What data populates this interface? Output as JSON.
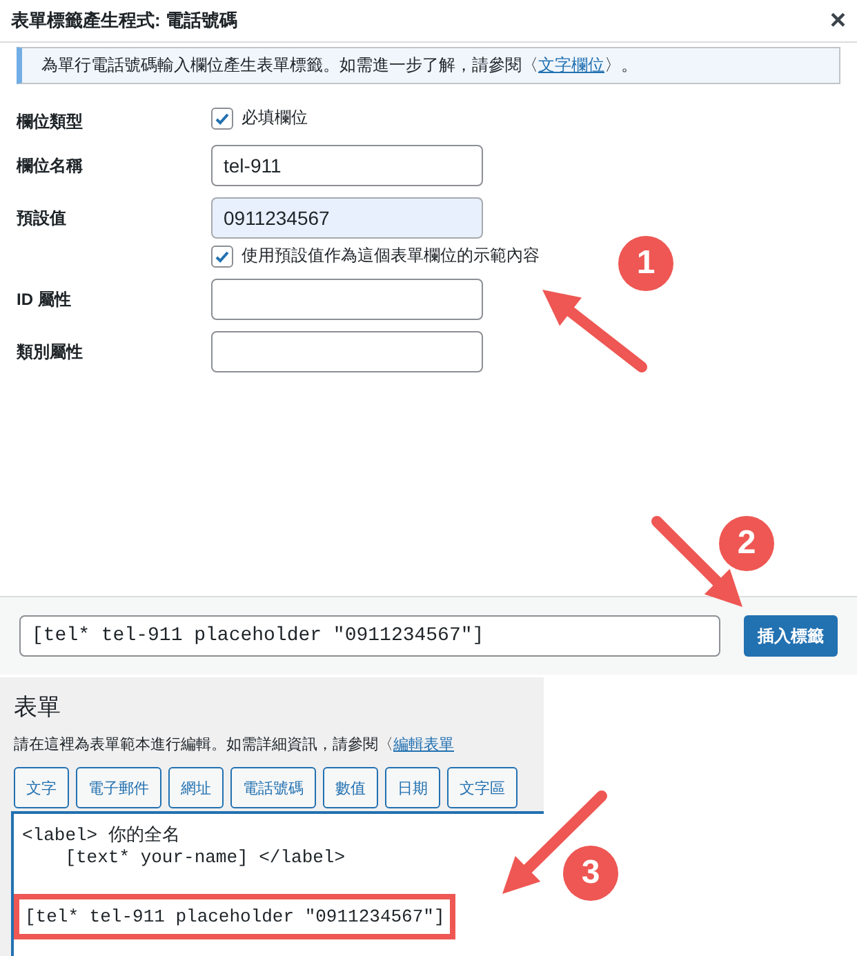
{
  "dialog": {
    "title": "表單標籤產生程式: 電話號碼",
    "close": "×",
    "notice": {
      "text": "為單行電話號碼輸入欄位產生表單標籤。如需進一步了解，請參閱〈",
      "link": "文字欄位",
      "after": "〉。"
    },
    "rows": [
      {
        "kind": "checkbox",
        "label": "欄位類型",
        "option": "必填欄位",
        "checked": true
      },
      {
        "kind": "input",
        "label": "欄位名稱",
        "value": "tel-911",
        "focused": false
      },
      {
        "kind": "input",
        "label": "預設值",
        "value": "0911234567",
        "focused": true,
        "option": "使用預設值作為這個表單欄位的示範內容",
        "checked": true
      },
      {
        "kind": "input",
        "label": "ID 屬性",
        "value": "",
        "focused": false
      },
      {
        "kind": "input",
        "label": "類別屬性",
        "value": "",
        "focused": false
      }
    ],
    "footer": {
      "tag": "[tel* tel-911 placeholder \"0911234567\"]",
      "button": "插入標籤"
    }
  },
  "form_panel": {
    "heading": "表單",
    "description": "請在這裡為表單範本進行編輯。如需詳細資訊，請參閱〈",
    "link": "編輯表單",
    "tag_buttons": [
      "文字",
      "電子郵件",
      "網址",
      "電話號碼",
      "數值",
      "日期",
      "文字區"
    ],
    "editor_lines": [
      {
        "text": "<label> 你的全名",
        "highlighted": false
      },
      {
        "text": "    [text* your-name] </label>",
        "highlighted": false
      },
      {
        "text": "[tel* tel-911 placeholder \"0911234567\"]",
        "highlighted": true
      }
    ]
  },
  "annotations": [
    {
      "number": "1"
    },
    {
      "number": "2"
    },
    {
      "number": "3"
    }
  ]
}
